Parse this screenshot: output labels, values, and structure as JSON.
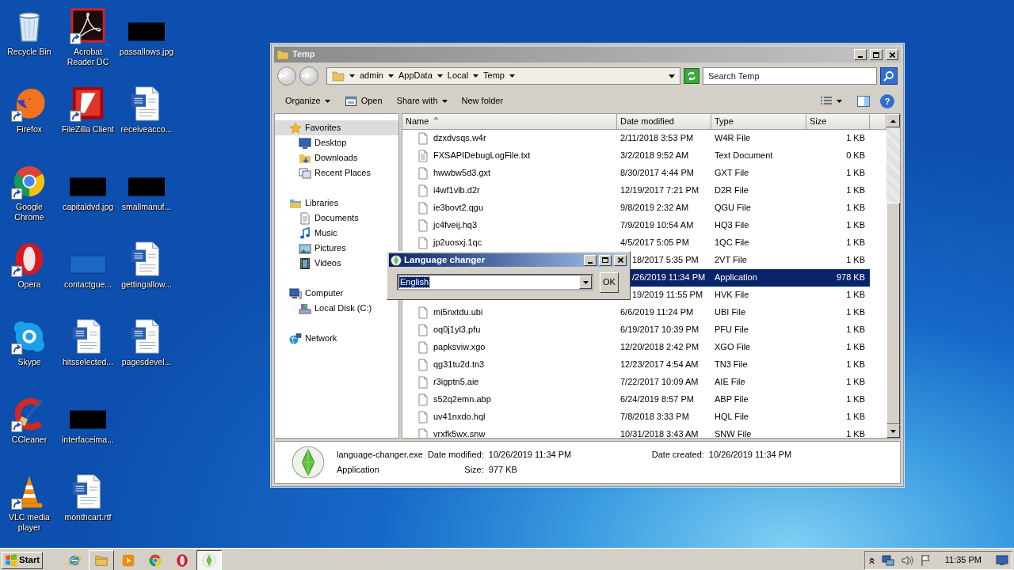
{
  "desktop_icons": [
    {
      "label": "Recycle Bin",
      "kind": "trash",
      "shortcut": false
    },
    {
      "label": "Firefox",
      "kind": "firefox",
      "shortcut": true
    },
    {
      "label": "Google Chrome",
      "kind": "chrome",
      "shortcut": true
    },
    {
      "label": "Opera",
      "kind": "opera",
      "shortcut": true
    },
    {
      "label": "Skype",
      "kind": "skype",
      "shortcut": true
    },
    {
      "label": "CCleaner",
      "kind": "ccleaner",
      "shortcut": true
    },
    {
      "label": "VLC media player",
      "kind": "vlc",
      "shortcut": true
    },
    {
      "label": "Acrobat Reader DC",
      "kind": "pdf",
      "shortcut": true
    },
    {
      "label": "FileZilla Client",
      "kind": "filezilla",
      "shortcut": true
    },
    {
      "label": "capitaldvd.jpg",
      "kind": "redacted"
    },
    {
      "label": "contactgue...",
      "kind": "image"
    },
    {
      "label": "hitsselected...",
      "kind": "word",
      "shortcut": false
    },
    {
      "label": "interfaceima...",
      "kind": "redacted"
    },
    {
      "label": "monthcart.rtf",
      "kind": "word",
      "shortcut": false
    },
    {
      "label": "passallows.jpg",
      "kind": "redacted"
    },
    {
      "label": "receiveacco...",
      "kind": "word",
      "shortcut": false
    },
    {
      "label": "smallmanuf...",
      "kind": "redacted"
    },
    {
      "label": "gettingallow...",
      "kind": "word",
      "shortcut": false
    },
    {
      "label": "pagesdevel...",
      "kind": "word",
      "shortcut": false
    }
  ],
  "explorer": {
    "title": "Temp",
    "breadcrumb": [
      "admin",
      "AppData",
      "Local",
      "Temp"
    ],
    "search": {
      "placeholder": "Search Temp"
    },
    "toolbar": [
      {
        "label": "Organize",
        "dropdown": true,
        "icon": false
      },
      {
        "label": "Open",
        "dropdown": false,
        "icon": true
      },
      {
        "label": "Share with",
        "dropdown": true,
        "icon": false
      },
      {
        "label": "New folder",
        "dropdown": false,
        "icon": false
      }
    ],
    "help": "?",
    "nav": [
      {
        "label": "Favorites",
        "kind": "star",
        "selected": true,
        "children": [
          {
            "label": "Desktop",
            "kind": "desktop",
            "selected": false
          },
          {
            "label": "Downloads",
            "kind": "downloads",
            "selected": false
          },
          {
            "label": "Recent Places",
            "kind": "recent",
            "selected": false
          }
        ]
      },
      {
        "label": "Libraries",
        "kind": "libraries",
        "selected": false,
        "children": [
          {
            "label": "Documents",
            "kind": "documents",
            "selected": false
          },
          {
            "label": "Music",
            "kind": "music",
            "selected": false
          },
          {
            "label": "Pictures",
            "kind": "pictures",
            "selected": false
          },
          {
            "label": "Videos",
            "kind": "videos",
            "selected": false
          }
        ]
      },
      {
        "label": "Computer",
        "kind": "computer",
        "selected": false,
        "children": [
          {
            "label": "Local Disk (C:)",
            "kind": "disk",
            "selected": false
          }
        ]
      },
      {
        "label": "Network",
        "kind": "network",
        "selected": false
      }
    ],
    "columns": [
      {
        "label": "Name",
        "sorted": true
      },
      {
        "label": "Date modified",
        "sorted": false
      },
      {
        "label": "Type",
        "sorted": false
      },
      {
        "label": "Size",
        "sorted": false
      }
    ],
    "rows": [
      {
        "name": "dzxdvsqs.w4r",
        "kind": "file",
        "date": "2/11/2018 3:53 PM",
        "type": "W4R File",
        "size": "1 KB",
        "selected": false
      },
      {
        "name": "FXSAPIDebugLogFile.txt",
        "kind": "text",
        "date": "3/2/2018 9:52 AM",
        "type": "Text Document",
        "size": "0 KB",
        "selected": false
      },
      {
        "name": "hwwbw5d3.gxt",
        "kind": "file",
        "date": "8/30/2017 4:44 PM",
        "type": "GXT File",
        "size": "1 KB",
        "selected": false
      },
      {
        "name": "i4wf1vlb.d2r",
        "kind": "file",
        "date": "12/19/2017 7:21 PM",
        "type": "D2R File",
        "size": "1 KB",
        "selected": false
      },
      {
        "name": "ie3bovt2.qgu",
        "kind": "file",
        "date": "9/8/2019 2:32 AM",
        "type": "QGU File",
        "size": "1 KB",
        "selected": false
      },
      {
        "name": "jc4fveij.hq3",
        "kind": "file",
        "date": "7/9/2019 10:54 AM",
        "type": "HQ3 File",
        "size": "1 KB",
        "selected": false
      },
      {
        "name": "jp2uosxj.1qc",
        "kind": "file",
        "date": "4/5/2017 5:05 PM",
        "type": "1QC File",
        "size": "1 KB",
        "selected": false
      },
      {
        "date": "18/2017 5:35 PM",
        "type": "2VT File",
        "size": "1 KB",
        "selected": false
      },
      {
        "date": "/26/2019 11:34 PM",
        "type": "Application",
        "size": "978 KB",
        "selected": true
      },
      {
        "date": "19/2019 11:55 PM",
        "type": "HVK File",
        "size": "1 KB",
        "selected": false
      },
      {
        "name": "mi5nxtdu.ubi",
        "kind": "file",
        "date": "6/6/2019 11:24 PM",
        "type": "UBI File",
        "size": "1 KB",
        "selected": false
      },
      {
        "name": "oq0j1yl3.pfu",
        "kind": "file",
        "date": "6/19/2017 10:39 PM",
        "type": "PFU File",
        "size": "1 KB",
        "selected": false
      },
      {
        "name": "papksviw.xgo",
        "kind": "file",
        "date": "12/20/2018 2:42 PM",
        "type": "XGO File",
        "size": "1 KB",
        "selected": false
      },
      {
        "name": "qg31tu2d.tn3",
        "kind": "file",
        "date": "12/23/2017 4:54 AM",
        "type": "TN3 File",
        "size": "1 KB",
        "selected": false
      },
      {
        "name": "r3igptn5.aie",
        "kind": "file",
        "date": "7/22/2017 10:09 AM",
        "type": "AIE File",
        "size": "1 KB",
        "selected": false
      },
      {
        "name": "s52q2emn.abp",
        "kind": "file",
        "date": "6/24/2019 8:57 PM",
        "type": "ABP File",
        "size": "1 KB",
        "selected": false
      },
      {
        "name": "uv41nxdo.hql",
        "kind": "file",
        "date": "7/8/2018 3:33 PM",
        "type": "HQL File",
        "size": "1 KB",
        "selected": false
      },
      {
        "name": "vrxfk5wx.snw",
        "kind": "file",
        "date": "10/31/2018 3:43 AM",
        "type": "SNW File",
        "size": "1 KB",
        "selected": false
      }
    ],
    "details": {
      "name": "language-changer.exe",
      "type": "Application",
      "properties": [
        {
          "label": "Date modified:",
          "value": "10/26/2019 11:34 PM"
        },
        {
          "label": "Date created:",
          "value": "10/26/2019 11:34 PM"
        },
        {
          "label": "Size:",
          "value": "977 KB"
        }
      ]
    }
  },
  "dialog": {
    "title": "Language changer",
    "combo": {
      "value": "English",
      "text_selected": true
    },
    "button": "OK"
  },
  "taskbar": {
    "start": "Start",
    "items": [
      {
        "kind": "ie",
        "running": false,
        "active": false
      },
      {
        "kind": "explorer",
        "running": true,
        "active": false
      },
      {
        "kind": "media",
        "running": false,
        "active": false
      },
      {
        "kind": "chrome",
        "running": false,
        "active": false
      },
      {
        "kind": "opera",
        "running": false,
        "active": false
      },
      {
        "kind": "gem",
        "running": true,
        "active": true
      }
    ],
    "clock": "11:35 PM"
  }
}
